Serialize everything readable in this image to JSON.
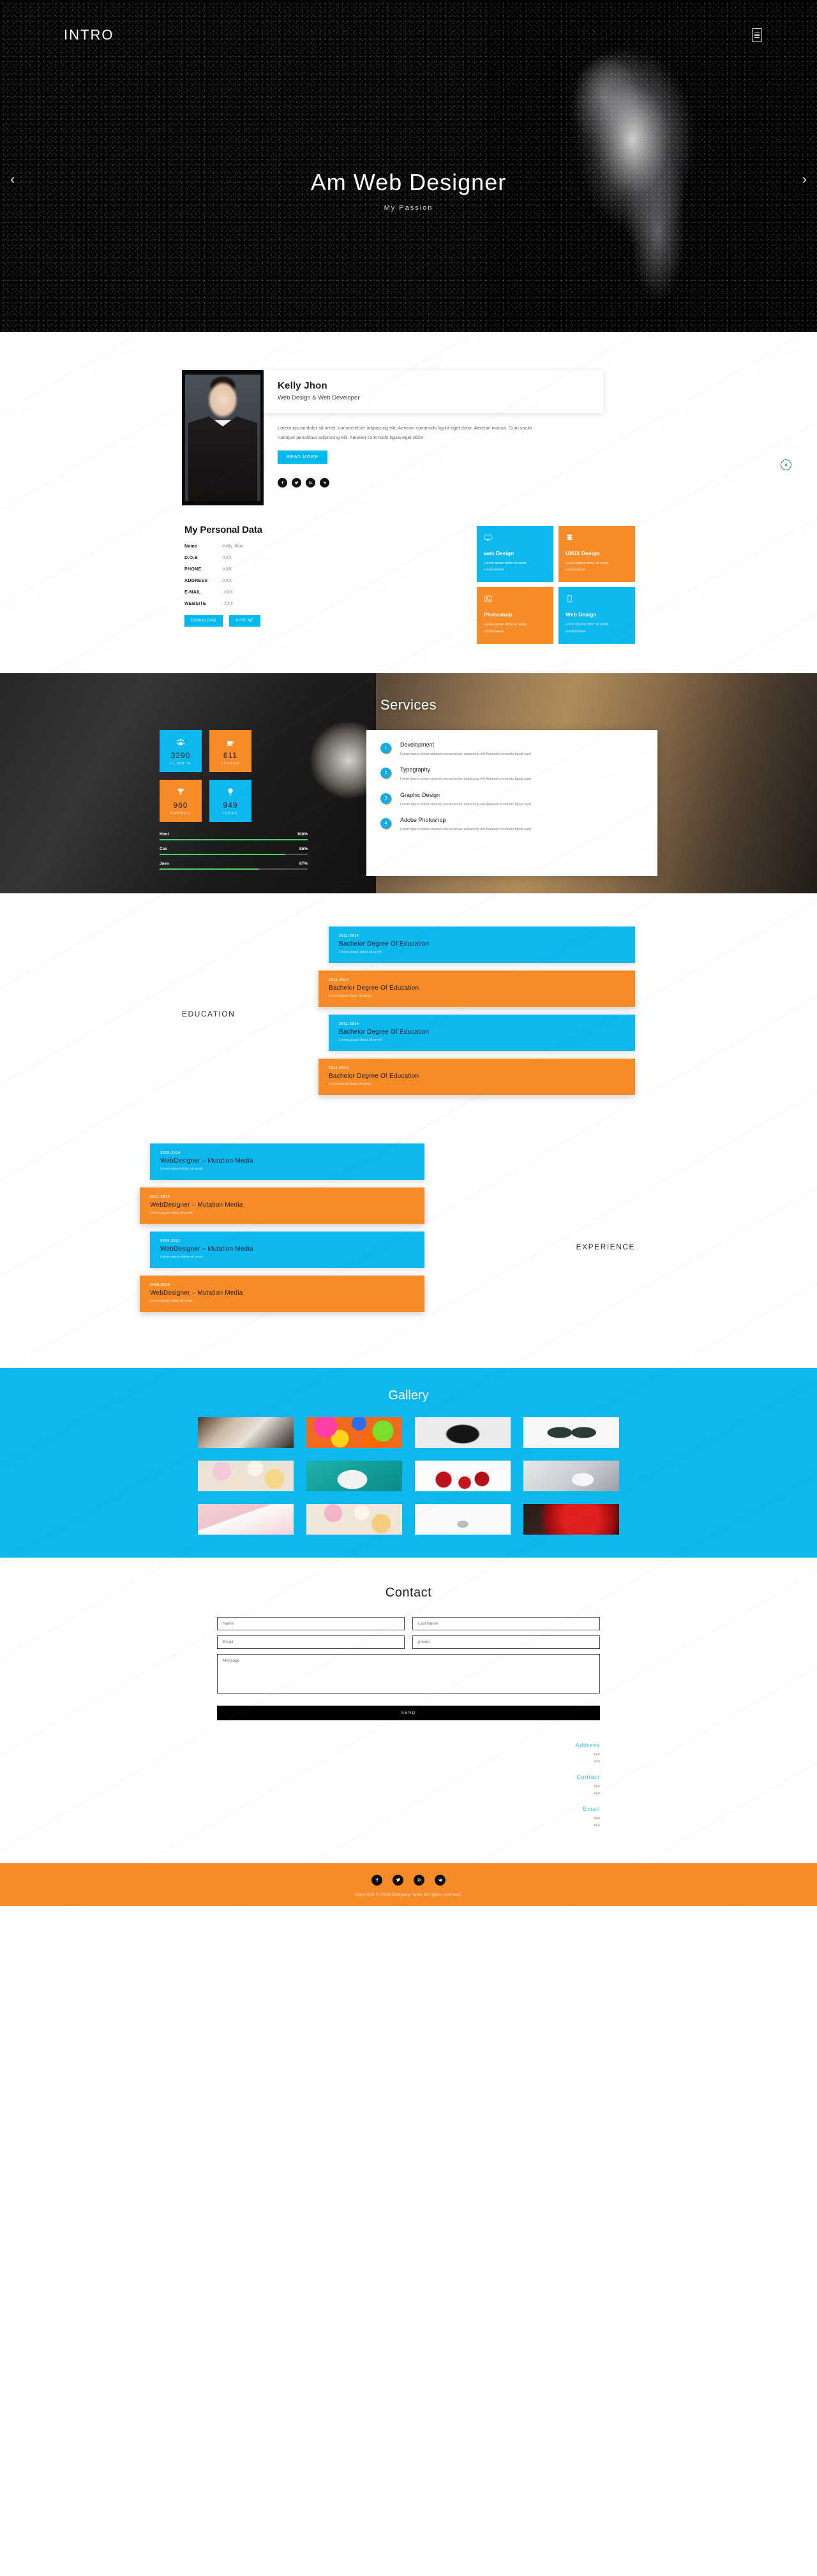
{
  "hero": {
    "brand": "INTRO",
    "menu_icon": "menu-icon",
    "title": "Am Web Designer",
    "subtitle": "My Passion",
    "prev_arrow": "‹",
    "next_arrow": "›"
  },
  "about": {
    "name": "Kelly Jhon",
    "role": "Web Design & Web Developer",
    "bio": "Lorem ipsum dolor sit amet, consectetuer adipiscing elit. Aenean commodo ligula eget dolor. Aenean massa. Cum sociis natoque penatibus adipiscing elit. Aenean commodo ligula eget dolor.",
    "read_more_label": "READ MORE",
    "social": [
      "facebook-icon",
      "twitter-icon",
      "rss-icon",
      "vk-icon"
    ],
    "scroll_top_icon": "scroll-to-top-icon"
  },
  "personal_data": {
    "heading": "My Personal Data",
    "rows": [
      {
        "key": "Name",
        "value": ":Kelly Jhon"
      },
      {
        "key": "D.O.B",
        "value": ":XXX"
      },
      {
        "key": "PHONE",
        "value": ":XXX"
      },
      {
        "key": "ADDRESS",
        "value": ":XXX"
      },
      {
        "key": "E-MAIL",
        "value": ": XXX"
      },
      {
        "key": "WEBSITE",
        "value": ": XXX"
      }
    ],
    "download_label": "DOWNLOAD",
    "hire_label": "HIRE ME"
  },
  "service_cards": [
    {
      "title": "web Design",
      "desc": "Lorem ipsum dolor sit amet, consectetuer",
      "color": "blue",
      "icon": "monitor-icon"
    },
    {
      "title": "UI/UX Design",
      "desc": "Lorem ipsum dolor sit amet, consectetuer",
      "color": "orange",
      "icon": "database-icon"
    },
    {
      "title": "Photoshop",
      "desc": "Lorem ipsum dolor sit amet, consectetuer",
      "color": "orange",
      "icon": "image-icon"
    },
    {
      "title": "Web Design",
      "desc": "Lorem ipsum dolor sit amet, consectetuer",
      "color": "blue",
      "icon": "mobile-icon"
    }
  ],
  "services": {
    "heading": "Services",
    "counters": [
      {
        "value": "3290",
        "label": "CLIENTS",
        "color": "blue",
        "icon": "users-icon"
      },
      {
        "value": "611",
        "label": "COFFEE",
        "color": "orange",
        "icon": "coffee-icon"
      },
      {
        "value": "960",
        "label": "AWARDS",
        "color": "orange",
        "icon": "trophy-icon"
      },
      {
        "value": "949",
        "label": "IDEAS",
        "color": "blue",
        "icon": "lightbulb-icon"
      }
    ],
    "skills": [
      {
        "name": "Html",
        "percent_label": "100%",
        "percent": 100
      },
      {
        "name": "Css",
        "percent_label": "85%",
        "percent": 85
      },
      {
        "name": "Java",
        "percent_label": "67%",
        "percent": 67
      }
    ],
    "items": [
      {
        "num": "1",
        "title": "Development",
        "desc": "Lorem ipsum dolor sitamet,consectetuer adipiscing elit.Aenean commodo ligula eget"
      },
      {
        "num": "2",
        "title": "Typography",
        "desc": "Lorem ipsum dolor sitamet,consectetuer adipiscing elit.Aenean commodo ligula eget"
      },
      {
        "num": "3",
        "title": "Graphic Design",
        "desc": "Lorem ipsum dolor sitamet,consectetuer adipiscing elit.Aenean commodo ligula eget"
      },
      {
        "num": "4",
        "title": "Adobe Photoshop",
        "desc": "Lorem ipsum dolor sitamet,consectetuer adipiscing elit.Aenean commodo ligula eget"
      }
    ]
  },
  "education": {
    "label": "EDUCATION",
    "items": [
      {
        "date": "2011-2014",
        "title": "Bachelor Degree Of Education",
        "desc": "Lorem ipsum dolor sit amet.",
        "color": "blue"
      },
      {
        "date": "2011-2014",
        "title": "Bachelor Degree Of Education",
        "desc": "Lorem ipsum dolor sit amet.",
        "color": "orange"
      },
      {
        "date": "2011-2014",
        "title": "Bachelor Degree Of Education",
        "desc": "Lorem ipsum dolor sit amet.",
        "color": "blue"
      },
      {
        "date": "2011-2014",
        "title": "Bachelor Degree Of Education",
        "desc": "Lorem ipsum dolor sit amet.",
        "color": "orange"
      }
    ]
  },
  "experience": {
    "label": "EXPERIENCE",
    "items": [
      {
        "date": "2012-2014",
        "title": "WebDesigner – Mutation Media",
        "desc": "Lorem ipsum dolor sit amet.",
        "color": "blue"
      },
      {
        "date": "2011-2012",
        "title": "WebDesigner – Mutation Media",
        "desc": "Lorem ipsum dolor sit amet.",
        "color": "orange"
      },
      {
        "date": "2009-2011",
        "title": "WebDesigner – Mutation Media",
        "desc": "Lorem ipsum dolor sit amet.",
        "color": "blue"
      },
      {
        "date": "2008-2009",
        "title": "WebDesigner – Mutation Media",
        "desc": "Lorem ipsum dolor sit amet.",
        "color": "orange"
      }
    ]
  },
  "gallery": {
    "heading": "Gallery",
    "items": [
      "desk-laptop-photo",
      "colorful-balloons-photo",
      "vintage-camera-photo",
      "sunglasses-photo",
      "ice-cream-cones-photo",
      "teal-phone-earphones-photo",
      "cherries-stars-photo",
      "white-mouse-photo",
      "pink-desk-keyboard-photo",
      "ice-cream-cones-photo-2",
      "white-spoon-photo",
      "red-dice-photo"
    ]
  },
  "contact": {
    "heading": "Contact",
    "fields": {
      "name_placeholder": "Name",
      "last_name_placeholder": "Last Name",
      "email_placeholder": "Email",
      "phone_placeholder": "phone",
      "message_placeholder": "Message"
    },
    "send_label": "SEND",
    "info": [
      {
        "title": "Address",
        "lines": [
          "xxx",
          "xxx"
        ]
      },
      {
        "title": "Contact",
        "lines": [
          "xxx",
          "xxx"
        ]
      },
      {
        "title": "Email",
        "lines": [
          "xxx",
          "xxx"
        ]
      }
    ]
  },
  "footer": {
    "social": [
      "facebook-icon",
      "twitter-icon",
      "rss-icon",
      "vk-icon"
    ],
    "copyright": "Copyright © 2020.Company name All rights reserved."
  },
  "colors": {
    "blue": "#0cb8ee",
    "orange": "#f68b28",
    "accent_cyan": "#2fc2ef",
    "dark": "#0d0d0d",
    "skill_green": "#4fd16a"
  }
}
